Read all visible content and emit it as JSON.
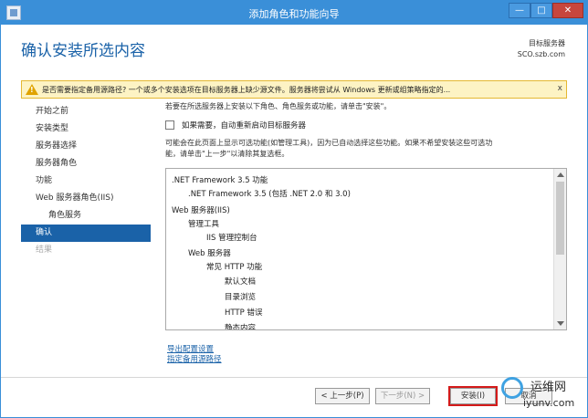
{
  "window": {
    "title": "添加角色和功能向导",
    "min_label": "—",
    "max_label": "□",
    "close_label": "✕"
  },
  "header": {
    "title": "确认安装所选内容",
    "target_label": "目标服务器",
    "target_value": "SCO.szb.com"
  },
  "warning": {
    "text": "是否需要指定备用源路径? 一个或多个安装选项在目标服务器上缺少源文件。服务器将尝试从 Windows 更新或组策略指定的...",
    "close": "x"
  },
  "sidebar": {
    "items": [
      {
        "label": "开始之前"
      },
      {
        "label": "安装类型"
      },
      {
        "label": "服务器选择"
      },
      {
        "label": "服务器角色"
      },
      {
        "label": "功能"
      },
      {
        "label": "Web 服务器角色(IIS)"
      },
      {
        "label": "角色服务"
      },
      {
        "label": "确认"
      },
      {
        "label": "结果"
      }
    ]
  },
  "main": {
    "intro": "若要在所选服务器上安装以下角色、角色服务或功能，请单击\"安装\"。",
    "restart_checkbox_label": "如果需要，自动重新启动目标服务器",
    "desc_line1": "可能会在此页面上显示可选功能(如管理工具)，因为已自动选择这些功能。如果不希望安装这些可选功",
    "desc_line2": "能，请单击\"上一步\"以清除其复选框。",
    "features": [
      ".NET Framework 3.5 功能",
      ".NET Framework 3.5 (包括 .NET 2.0 和 3.0)",
      "Web 服务器(IIS)",
      "管理工具",
      "IIS 管理控制台",
      "Web 服务器",
      "常见 HTTP 功能",
      "默认文档",
      "目录浏览",
      "HTTP 错误",
      "静态内容"
    ],
    "export_link": "导出配置设置",
    "alt_source_link": "指定备用源路径"
  },
  "footer": {
    "prev": "< 上一步(P)",
    "next": "下一步(N) >",
    "install": "安装(I)",
    "cancel": "取消"
  },
  "watermark": {
    "line1": "运维网",
    "line2": "iyunv.com"
  }
}
